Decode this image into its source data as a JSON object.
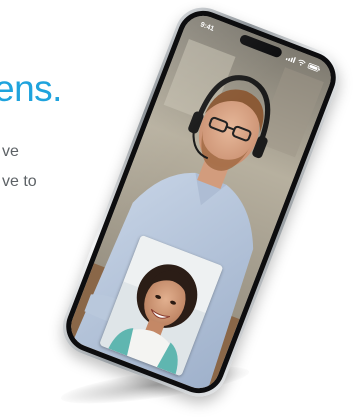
{
  "headline": "ens.",
  "body_lines": [
    "ve",
    "ve to"
  ],
  "phone": {
    "status_time": "9:41",
    "status_icons": [
      "signal-icon",
      "wifi-icon",
      "battery-icon"
    ],
    "main_video": "remote-participant-video",
    "pip_video": "self-view-video"
  },
  "colors": {
    "accent": "#1fa3dd",
    "body_text": "#5d6266",
    "phone_frame": "#0d0d0f"
  }
}
